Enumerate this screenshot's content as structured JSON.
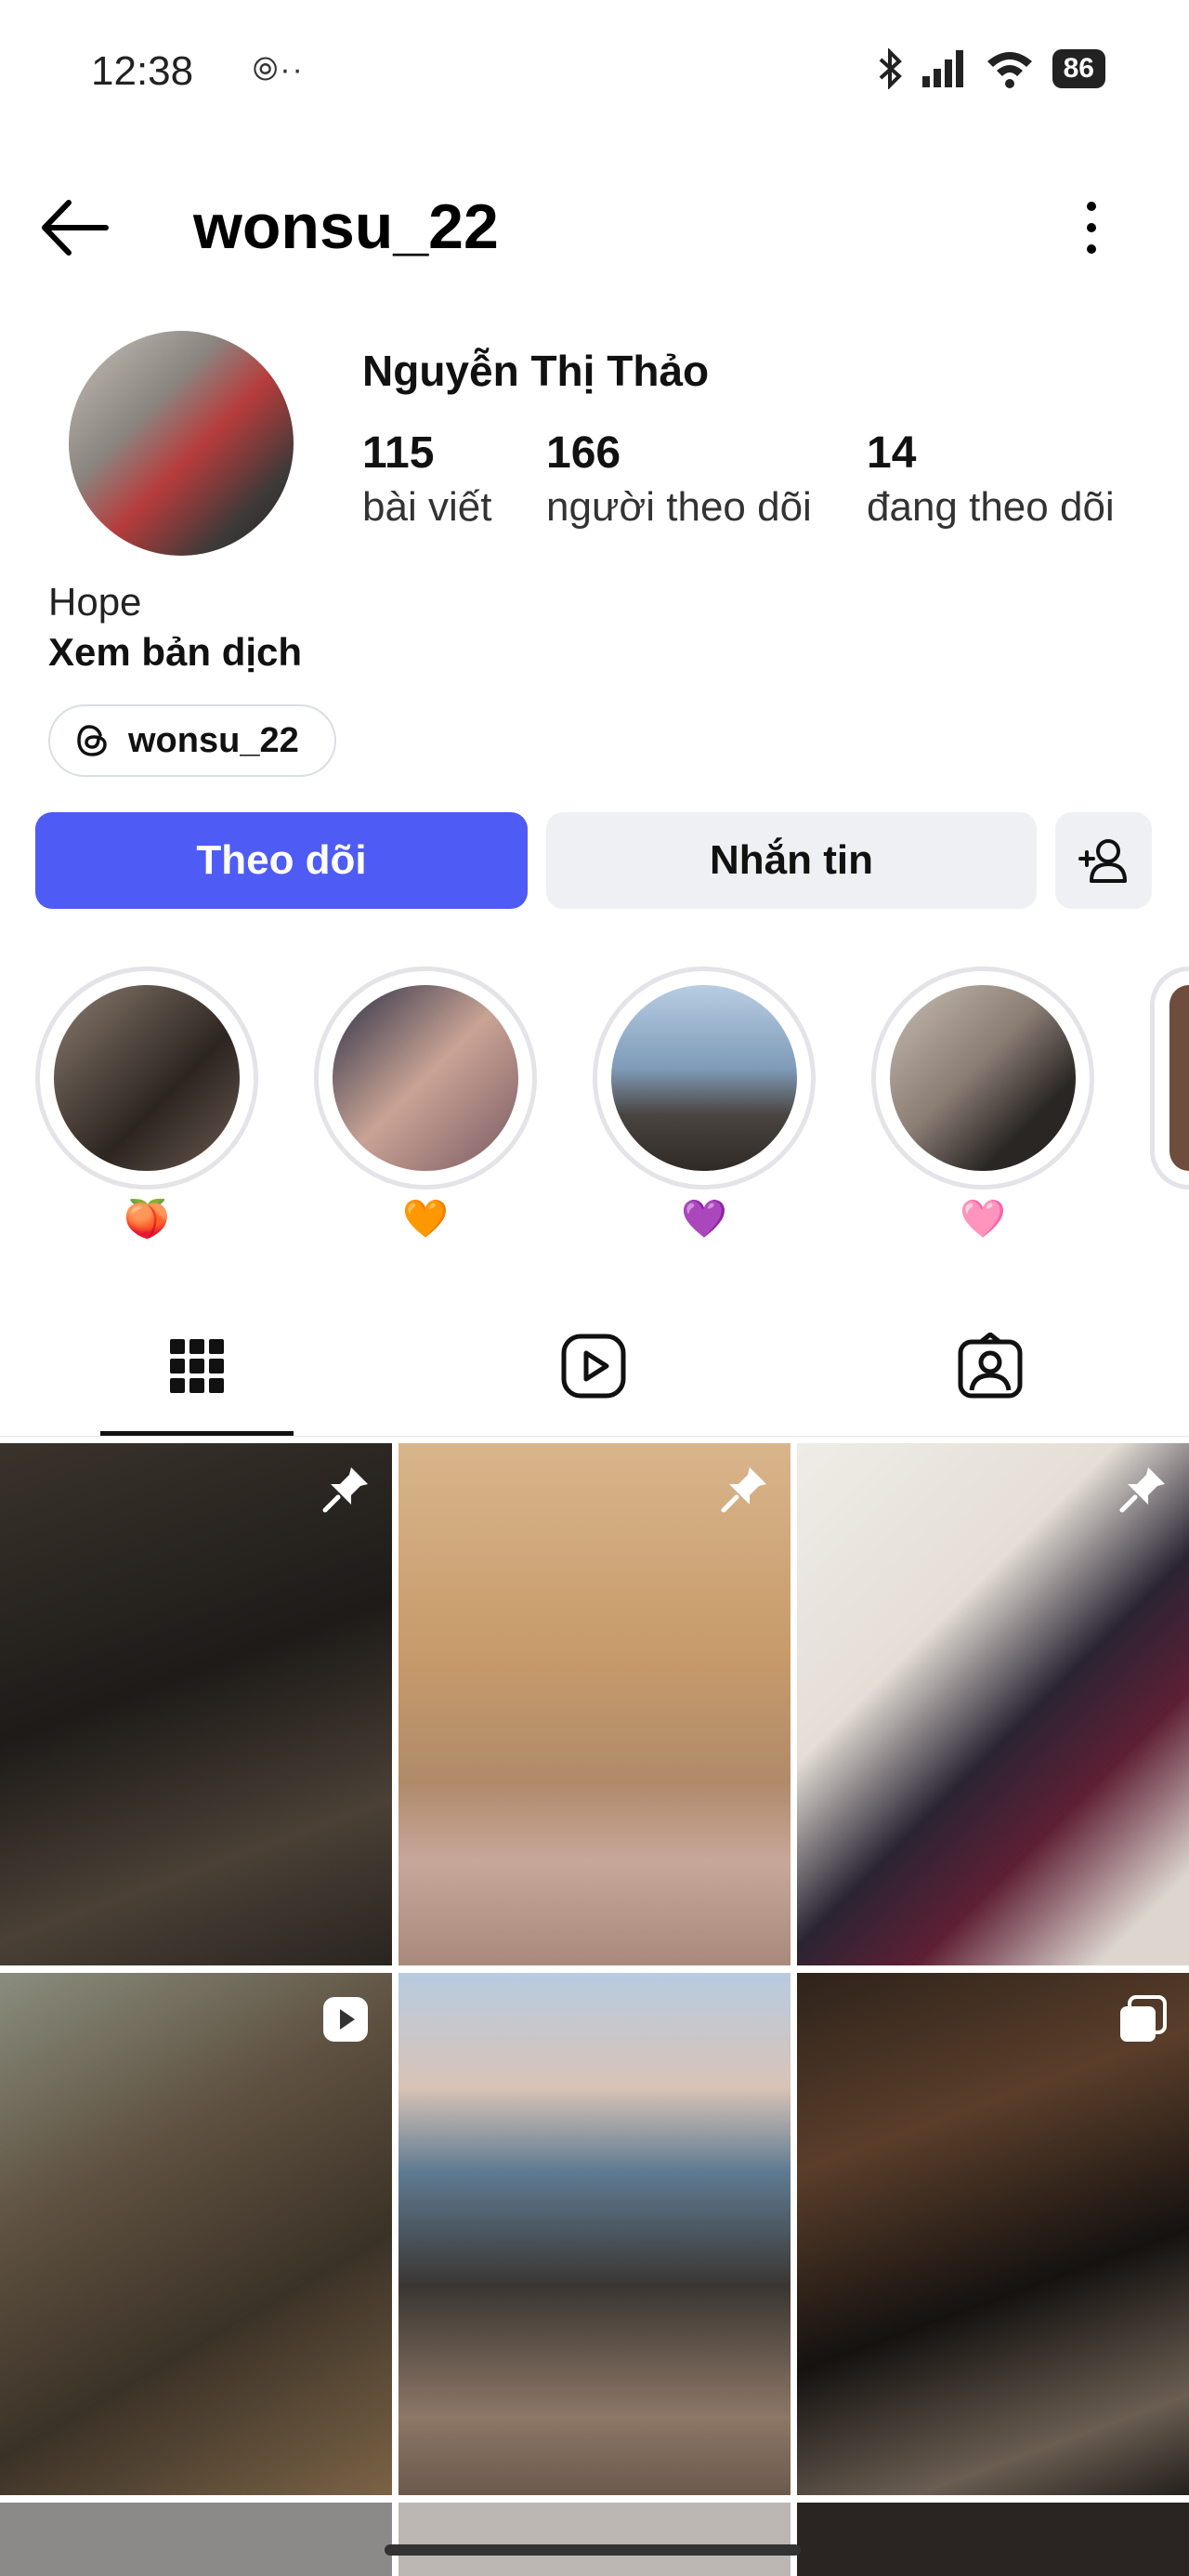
{
  "status_bar": {
    "time": "12:38",
    "extra": "⦾··",
    "battery": "86"
  },
  "header": {
    "username": "wonsu_22"
  },
  "profile": {
    "full_name": "Nguyễn Thị Thảo",
    "stats": [
      {
        "value": "115",
        "label": "bài viết"
      },
      {
        "value": "166",
        "label": "người theo dõi"
      },
      {
        "value": "14",
        "label": "đang theo dõi"
      }
    ],
    "bio": "Hope",
    "translate": "Xem bản dịch",
    "threads_handle": "wonsu_22"
  },
  "actions": {
    "follow": "Theo dõi",
    "message": "Nhắn tin"
  },
  "highlights": [
    {
      "emoji": "🍑",
      "color": "#6a5a52"
    },
    {
      "emoji": "🧡",
      "color": "#7a5a63"
    },
    {
      "emoji": "💜",
      "color": "#7f9bb8"
    },
    {
      "emoji": "🩷",
      "color": "#8a7d74"
    }
  ],
  "tabs": [
    "grid-tab",
    "reels-tab",
    "tagged-tab"
  ],
  "posts": [
    {
      "type": "pinned",
      "colors": [
        "#2a2622",
        "#463e35"
      ]
    },
    {
      "type": "pinned",
      "colors": [
        "#c79b6a",
        "#b9a192"
      ]
    },
    {
      "type": "pinned",
      "colors": [
        "#e8e4dd",
        "#2a2433"
      ]
    },
    {
      "type": "reel",
      "colors": [
        "#5e5140",
        "#3b3227"
      ]
    },
    {
      "type": "photo",
      "colors": [
        "#9fb6cf",
        "#6b5a4c"
      ]
    },
    {
      "type": "carousel",
      "colors": [
        "#3b2e24",
        "#151210"
      ]
    }
  ]
}
